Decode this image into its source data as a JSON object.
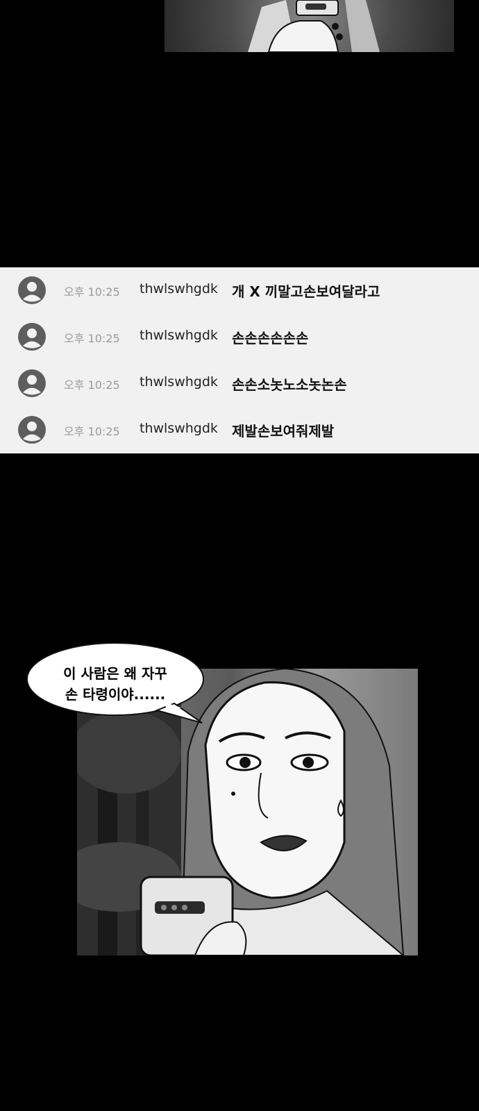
{
  "chat": {
    "messages": [
      {
        "time": "오후 10:25",
        "user": "thwlswhgdk",
        "text": "개 X 끼말고손보여달라고"
      },
      {
        "time": "오후 10:25",
        "user": "thwlswhgdk",
        "text": "손손손손손손"
      },
      {
        "time": "오후 10:25",
        "user": "thwlswhgdk",
        "text": "손손소놋노소놋논손"
      },
      {
        "time": "오후 10:25",
        "user": "thwlswhgdk",
        "text": "제발손보여줘제발"
      }
    ]
  },
  "speech": {
    "line1": "이 사람은 왜 자꾸",
    "line2": "손 타령이야......"
  },
  "colors": {
    "background": "#000000",
    "chat_strip": "#f1f1f1",
    "avatar": "#5e5e5e"
  }
}
